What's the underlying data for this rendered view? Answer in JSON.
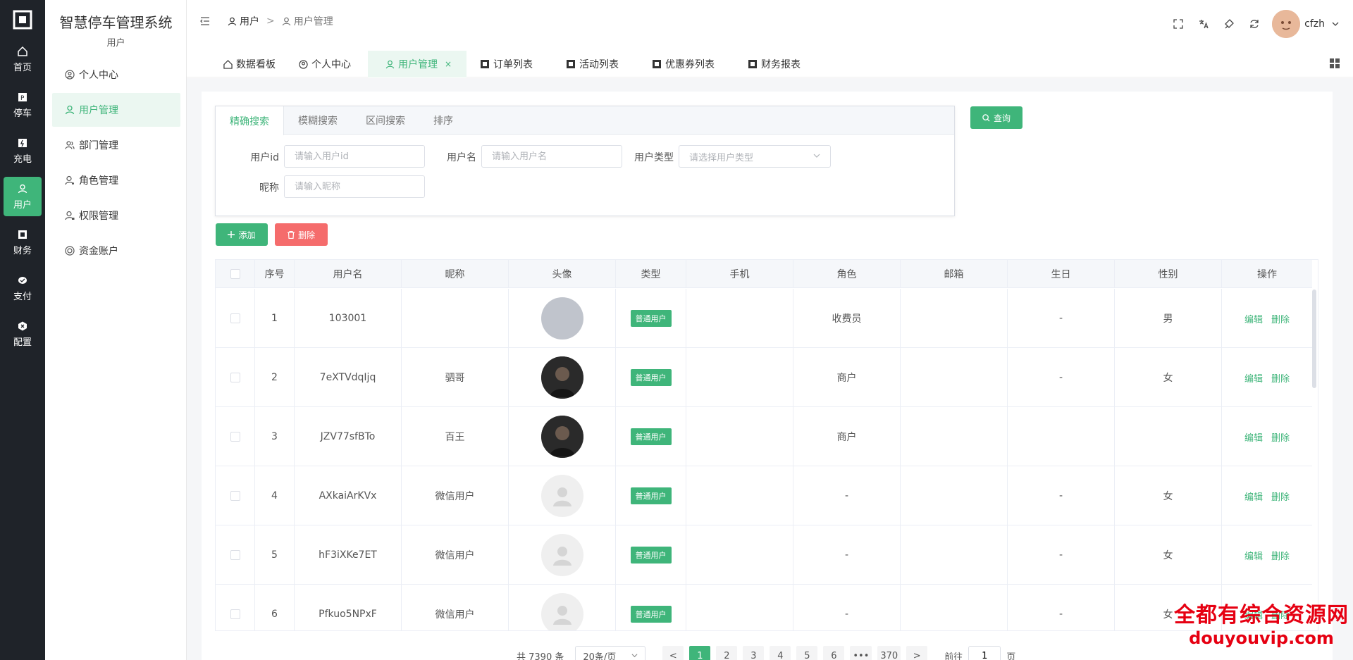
{
  "rail": {
    "items": [
      {
        "label": "首页",
        "icon": "home-icon"
      },
      {
        "label": "停车",
        "icon": "parking-icon"
      },
      {
        "label": "充电",
        "icon": "charge-icon"
      },
      {
        "label": "用户",
        "icon": "user-icon",
        "active": true
      },
      {
        "label": "财务",
        "icon": "finance-icon"
      },
      {
        "label": "支付",
        "icon": "pay-icon"
      },
      {
        "label": "配置",
        "icon": "config-icon"
      }
    ]
  },
  "sidebar": {
    "title": "智慧停车管理系统",
    "subtitle": "用户",
    "items": [
      {
        "label": "个人中心",
        "icon": "user-circle-icon"
      },
      {
        "label": "用户管理",
        "icon": "user-icon",
        "active": true
      },
      {
        "label": "部门管理",
        "icon": "users-icon"
      },
      {
        "label": "角色管理",
        "icon": "role-icon"
      },
      {
        "label": "权限管理",
        "icon": "permission-icon"
      },
      {
        "label": "资金账户",
        "icon": "coins-icon"
      }
    ]
  },
  "header": {
    "breadcrumb": [
      "用户",
      "用户管理"
    ],
    "username": "cfzh"
  },
  "tabs": [
    {
      "label": "数据看板",
      "icon": "home-icon"
    },
    {
      "label": "个人中心",
      "icon": "user-circle-icon"
    },
    {
      "label": "用户管理",
      "icon": "user-icon",
      "active": true,
      "close": "×"
    },
    {
      "label": "订单列表",
      "icon": "list-icon"
    },
    {
      "label": "活动列表",
      "icon": "list-icon"
    },
    {
      "label": "优惠券列表",
      "icon": "list-icon"
    },
    {
      "label": "财务报表",
      "icon": "list-icon"
    }
  ],
  "search": {
    "tabs": [
      "精确搜索",
      "模糊搜索",
      "区间搜索",
      "排序"
    ],
    "fields": {
      "userid_label": "用户id",
      "userid_placeholder": "请输入用户id",
      "username_label": "用户名",
      "username_placeholder": "请输入用户名",
      "usertype_label": "用户类型",
      "usertype_placeholder": "请选择用户类型",
      "nickname_label": "昵称",
      "nickname_placeholder": "请输入昵称"
    },
    "query_label": "查询"
  },
  "actions": {
    "add_label": "添加",
    "delete_label": "删除"
  },
  "table": {
    "columns": [
      "序号",
      "用户名",
      "昵称",
      "头像",
      "类型",
      "手机",
      "角色",
      "邮箱",
      "生日",
      "性别",
      "操作"
    ],
    "rows": [
      {
        "no": "1",
        "username": "103001",
        "nickname": "",
        "avatar": "default",
        "type": "普通用户",
        "phone": "",
        "role": "收费员",
        "email": "",
        "birthday": "-",
        "gender": "男"
      },
      {
        "no": "2",
        "username": "7eXTVdqIjq",
        "nickname": "驷哥",
        "avatar": "dark",
        "type": "普通用户",
        "phone": "",
        "role": "商户",
        "email": "",
        "birthday": "-",
        "gender": "女"
      },
      {
        "no": "3",
        "username": "JZV77sfBTo",
        "nickname": "百王",
        "avatar": "dark",
        "type": "普通用户",
        "phone": "",
        "role": "商户",
        "email": "",
        "birthday": "",
        "gender": ""
      },
      {
        "no": "4",
        "username": "AXkaiArKVx",
        "nickname": "微信用户",
        "avatar": "grey",
        "type": "普通用户",
        "phone": "",
        "role": "-",
        "email": "",
        "birthday": "-",
        "gender": "女"
      },
      {
        "no": "5",
        "username": "hF3iXKe7ET",
        "nickname": "微信用户",
        "avatar": "grey",
        "type": "普通用户",
        "phone": "",
        "role": "-",
        "email": "",
        "birthday": "-",
        "gender": "女"
      },
      {
        "no": "6",
        "username": "Pfkuo5NPxF",
        "nickname": "微信用户",
        "avatar": "grey",
        "type": "普通用户",
        "phone": "",
        "role": "-",
        "email": "",
        "birthday": "-",
        "gender": "女"
      }
    ],
    "edit_label": "编辑",
    "delete_label": "删除"
  },
  "pagination": {
    "total": "共 7390 条",
    "page_size": "20条/页",
    "pages": [
      "1",
      "2",
      "3",
      "4",
      "5",
      "6",
      "•••",
      "370"
    ],
    "goto_prefix": "前往",
    "goto_value": "1",
    "goto_suffix": "页",
    "prev": "<",
    "next": ">"
  },
  "watermark": {
    "cn": "全都有综合资源网",
    "en": "douyouvip.com"
  },
  "colors": {
    "accent": "#3fb57a",
    "danger": "#f56c6c",
    "rail": "#1f2329"
  }
}
